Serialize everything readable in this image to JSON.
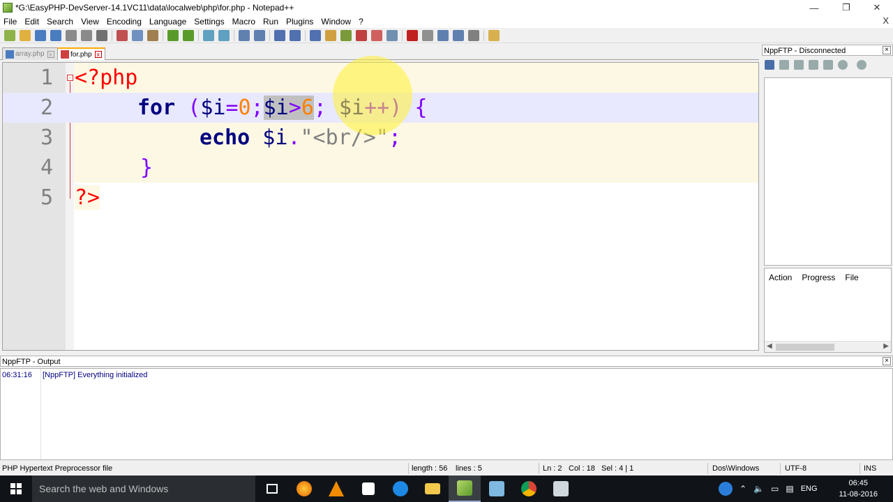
{
  "window": {
    "title": "*G:\\EasyPHP-DevServer-14.1VC11\\data\\localweb\\php\\for.php - Notepad++",
    "minimize": "—",
    "maximize": "❐",
    "close": "✕"
  },
  "menu": {
    "items": [
      "File",
      "Edit",
      "Search",
      "View",
      "Encoding",
      "Language",
      "Settings",
      "Macro",
      "Run",
      "Plugins",
      "Window",
      "?"
    ],
    "close": "X"
  },
  "tabs": [
    {
      "label": "array.php",
      "active": false
    },
    {
      "label": "for.php",
      "active": true
    }
  ],
  "editor": {
    "lines": [
      {
        "num": "1"
      },
      {
        "num": "2"
      },
      {
        "num": "3"
      },
      {
        "num": "4"
      },
      {
        "num": "5"
      }
    ],
    "tokens": {
      "open_tag": "<?php",
      "for_kw": "for",
      "paren_open": " (",
      "init": "$i",
      "init_eq": "=",
      "init_val": "0",
      "semi1": ";",
      "cond_var": "$i",
      "cond_op": ">",
      "cond_val": "6",
      "semi2": ";",
      "inc": " $i",
      "inc_op": "++",
      "paren_close": ")",
      "brace_open": " {",
      "echo_kw": "echo",
      "echo_var": " $i",
      "concat": ".",
      "echo_str": "\"<br/>\"",
      "semi3": ";",
      "brace_close": "}",
      "close_tag": "?>"
    }
  },
  "ftp": {
    "title": "NppFTP - Disconnected",
    "columns": [
      "Action",
      "Progress",
      "File"
    ]
  },
  "output": {
    "title": "NppFTP - Output",
    "time": "06:31:16",
    "message": "[NppFTP] Everything initialized"
  },
  "status": {
    "filetype": "PHP Hypertext Preprocessor file",
    "length": "length : 56",
    "lines": "lines : 5",
    "ln": "Ln : 2",
    "col": "Col : 18",
    "sel": "Sel : 4 | 1",
    "eol": "Dos\\Windows",
    "encoding": "UTF-8",
    "mode": "INS"
  },
  "taskbar": {
    "search_placeholder": "Search the web and Windows",
    "lang": "ENG",
    "time": "06:45",
    "date": "11-08-2016"
  },
  "colors": {
    "keyword": "#000080",
    "number": "#ff8000",
    "operator": "#8000ff",
    "string": "#808080",
    "php_tag": "#ff0000",
    "current_line": "#e8e8ff"
  }
}
